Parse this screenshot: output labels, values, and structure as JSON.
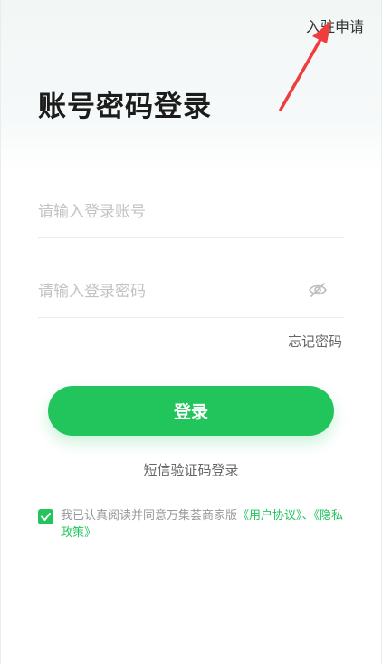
{
  "header": {
    "apply_label": "入驻申请"
  },
  "page_title": "账号密码登录",
  "form": {
    "account_placeholder": "请输入登录账号",
    "account_value": "",
    "password_placeholder": "请输入登录密码",
    "password_value": "",
    "forgot_label": "忘记密码",
    "login_label": "登录",
    "sms_login_label": "短信验证码登录"
  },
  "agreement": {
    "checked": true,
    "prefix": "我已认真阅读并同意万集荟商家版",
    "user_agreement": "《用户协议》",
    "separator": "、",
    "privacy_policy": "《隐私政策》"
  },
  "icons": {
    "eye": "eye-hidden-icon",
    "check": "check-icon",
    "arrow": "annotation-arrow-icon"
  },
  "colors": {
    "accent": "#22c55c",
    "arrow": "#f03c3c",
    "placeholder": "#c3c3c3",
    "muted_text": "#999999"
  }
}
